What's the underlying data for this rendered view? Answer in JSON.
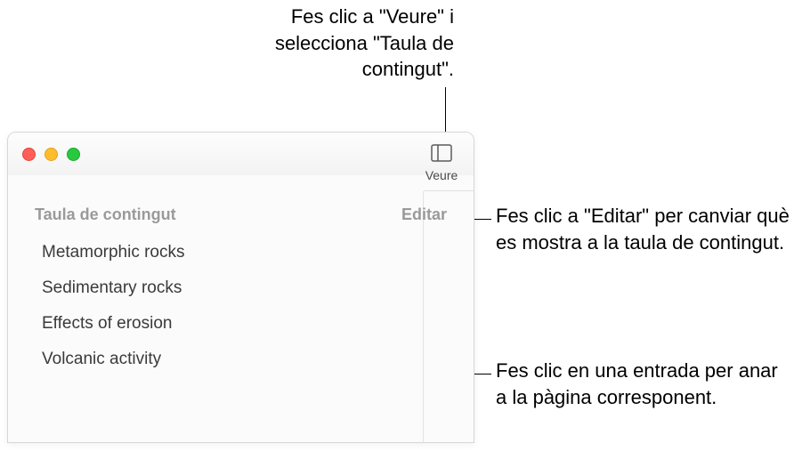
{
  "callouts": {
    "top": "Fes clic a \"Veure\" i selecciona \"Taula de contingut\".",
    "right1": "Fes clic a \"Editar\" per canviar què es mostra a la taula de contingut.",
    "right2": "Fes clic en una entrada per anar a la pàgina corresponent."
  },
  "toolbar": {
    "view_label": "Veure"
  },
  "sidebar": {
    "title": "Taula de contingut",
    "edit_label": "Editar",
    "items": [
      {
        "label": "Metamorphic rocks"
      },
      {
        "label": "Sedimentary rocks"
      },
      {
        "label": "Effects of erosion"
      },
      {
        "label": "Volcanic activity"
      }
    ]
  }
}
